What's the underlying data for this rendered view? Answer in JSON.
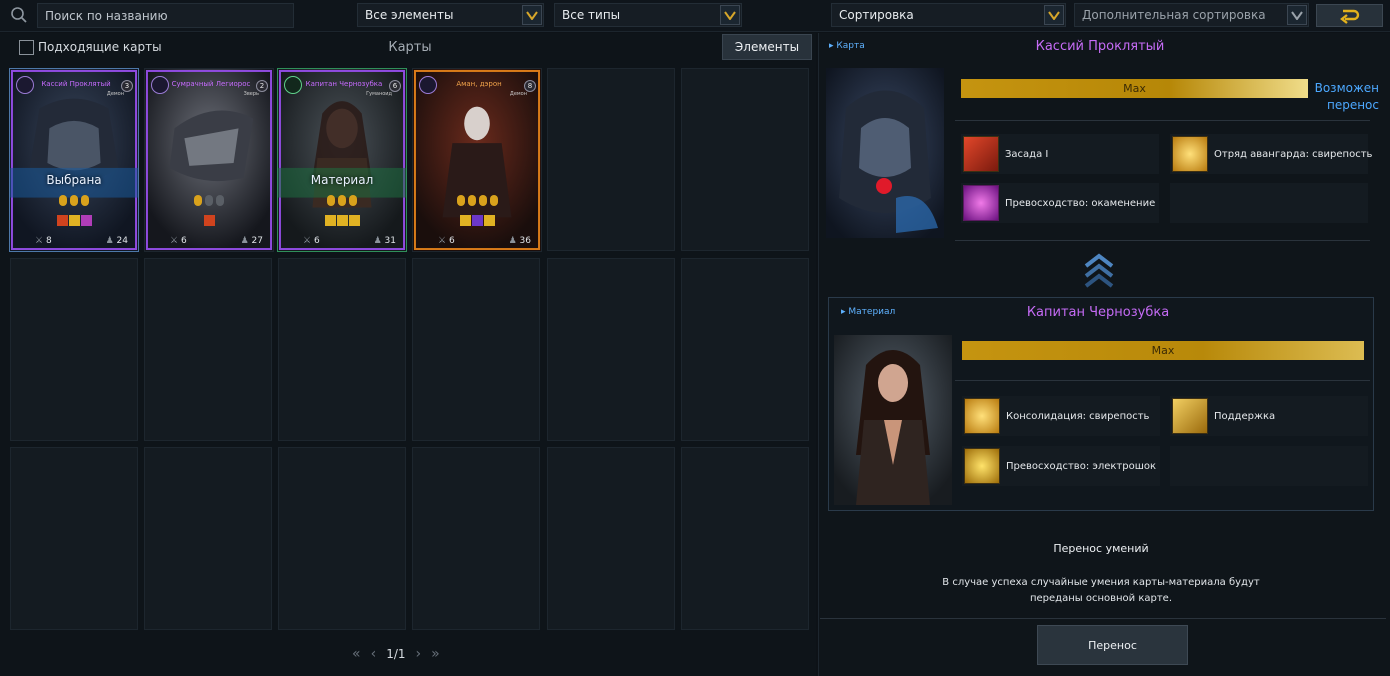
{
  "toolbar": {
    "search_placeholder": "Поиск по названию",
    "filter_elements": "Все элементы",
    "filter_types": "Все типы",
    "sort": "Сортировка",
    "extra_sort": "Дополнительная сортировка"
  },
  "left": {
    "checkbox_label": "Подходящие карты",
    "title": "Карты",
    "elements_button": "Элементы",
    "cards": [
      {
        "name": "Кассий Проклятый",
        "type": "Демон",
        "cost": "3",
        "badge": "Выбрана",
        "atk": "8",
        "hp": "24",
        "rarity": "epic"
      },
      {
        "name": "Сумрачный Легиорос",
        "type": "Зверь",
        "cost": "2",
        "badge": "",
        "atk": "6",
        "hp": "27",
        "rarity": "epic"
      },
      {
        "name": "Капитан Чернозубка",
        "type": "Гуманоид",
        "cost": "6",
        "badge": "Материал",
        "atk": "6",
        "hp": "31",
        "rarity": "epic"
      },
      {
        "name": "Аман, дэрон",
        "type": "Демон",
        "cost": "8",
        "badge": "",
        "atk": "6",
        "hp": "36",
        "rarity": "legendary"
      }
    ],
    "pager": "1/1"
  },
  "right": {
    "main": {
      "tag": "Карта",
      "name": "Кассий Проклятый",
      "level": "Max",
      "transfer_note": "Возможен перенос",
      "skills": [
        "Засада I",
        "Отряд авангарда: свирепость",
        "Превосходство: окаменение"
      ]
    },
    "material": {
      "tag": "Материал",
      "name": "Капитан Чернозубка",
      "level": "Max",
      "skills": [
        "Консолидация: свирепость",
        "Поддержка",
        "Превосходство: электрошок"
      ]
    },
    "info_title": "Перенос умений",
    "info_text": "В случае успеха случайные умения карты-материала будут переданы основной карте.",
    "transfer_button": "Перенос"
  },
  "colors": {
    "accent_blue": "#4ca8ff",
    "gold": "#c59410",
    "epic_purple": "#9b4ee0",
    "legendary_orange": "#d97b19"
  }
}
